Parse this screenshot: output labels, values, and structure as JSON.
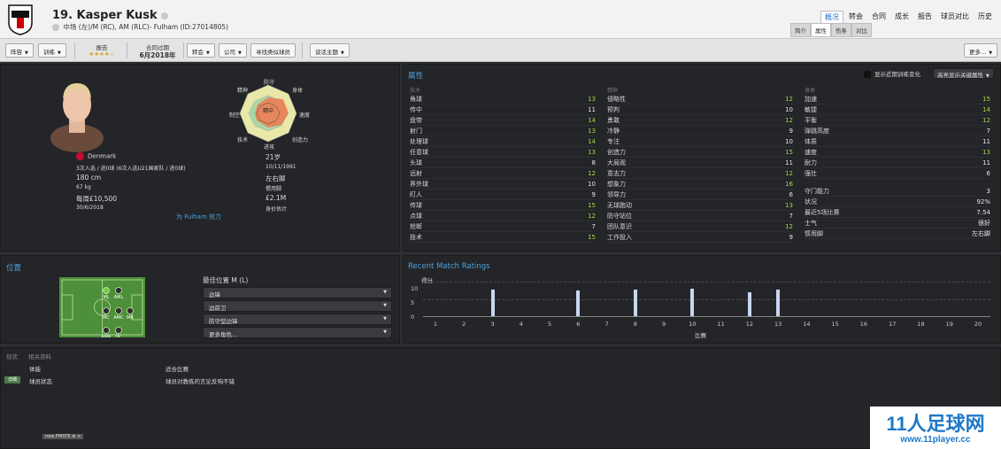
{
  "header": {
    "title": "19. Kasper Kusk",
    "subtitle": "中场 (左)/M (RC), AM (RLC)- Fulham (ID:27014805)",
    "nav": [
      "概况",
      "转会",
      "合同",
      "成长",
      "报告",
      "球员对比",
      "历史"
    ],
    "subnav": [
      "简介",
      "属性",
      "伤条",
      "对比"
    ]
  },
  "toolbar": {
    "lineup": "阵容",
    "training": "训练",
    "report_label": "报告",
    "report_stars": "★★★★☆",
    "contract_label": "合同过期",
    "contract_value": "6月2018年",
    "transfer": "转会",
    "club": "公司",
    "find_similar": "寻找类似球员",
    "talk": "谈话主题",
    "more": "更多..."
  },
  "profile": {
    "nation": "Denmark",
    "caps": "3次入选 / 进0球 (6次入选U21国家队 / 进0球)",
    "height": "180 cm",
    "weight": "67 kg",
    "wage": "每周£10,500",
    "contract_end": "30/6/2018",
    "age": "21岁",
    "dob": "10/11/1991",
    "foot": "左右脚",
    "foot_label": "惯用脚",
    "value": "£2.1M",
    "value_label": "身价估计",
    "club_link": "为 Fulham 效力"
  },
  "radar": {
    "labels": [
      "防守",
      "身体",
      "速度",
      "创造力",
      "进攻",
      "技术",
      "制空",
      "精神"
    ],
    "center": "精中"
  },
  "attributes": {
    "title": "属性",
    "toggle": "显示近期训练变化",
    "highlight": "高亮显示关键属性",
    "technical_header": "技术",
    "technical": [
      [
        "角球",
        "13"
      ],
      [
        "传中",
        "11"
      ],
      [
        "盘带",
        "14"
      ],
      [
        "射门",
        "13"
      ],
      [
        "处理球",
        "14"
      ],
      [
        "任意球",
        "13"
      ],
      [
        "头球",
        "8"
      ],
      [
        "远射",
        "12"
      ],
      [
        "界外球",
        "10"
      ],
      [
        "盯人",
        "9"
      ],
      [
        "传球",
        "15"
      ],
      [
        "点球",
        "12"
      ],
      [
        "抢断",
        "7"
      ],
      [
        "技术",
        "15"
      ]
    ],
    "mental_header": "精神",
    "mental": [
      [
        "侵略性",
        "12"
      ],
      [
        "预判",
        "10"
      ],
      [
        "勇敢",
        "12"
      ],
      [
        "冷静",
        "9"
      ],
      [
        "专注",
        "10"
      ],
      [
        "创造力",
        "15"
      ],
      [
        "大局观",
        "11"
      ],
      [
        "意志力",
        "12"
      ],
      [
        "想象力",
        "16"
      ],
      [
        "领导力",
        "6"
      ],
      [
        "无球跑动",
        "13"
      ],
      [
        "防守站位",
        "7"
      ],
      [
        "团队意识",
        "12"
      ],
      [
        "工作投入",
        "9"
      ]
    ],
    "physical_header": "身体",
    "physical": [
      [
        "加速",
        "15"
      ],
      [
        "敏捷",
        "14"
      ],
      [
        "平衡",
        "12"
      ],
      [
        "弹跳高度",
        "7"
      ],
      [
        "体质",
        "11"
      ],
      [
        "速度",
        "13"
      ],
      [
        "耐力",
        "11"
      ],
      [
        "强壮",
        "6"
      ]
    ],
    "gk": [
      [
        "守门能力",
        "3"
      ],
      [
        "状况",
        "92%"
      ],
      [
        "最近5场比赛",
        "7.54"
      ],
      [
        "士气",
        "很好"
      ],
      [
        "惯用脚",
        "左右脚"
      ]
    ]
  },
  "position": {
    "title": "位置",
    "best_label": "最佳位置 M (L)",
    "roles": [
      "边锋",
      "边前卫",
      "防守型边锋",
      "更多角色..."
    ],
    "pitch_labels": [
      "ML",
      "AML",
      "MC",
      "AMC",
      "MR",
      "AMR",
      "DC"
    ]
  },
  "ratings": {
    "title": "Recent Match Ratings",
    "ylabel": "得分",
    "xlabel": "比赛",
    "y_ticks": [
      "10",
      "5",
      "0"
    ]
  },
  "chart_data": {
    "type": "bar",
    "title": "Recent Match Ratings",
    "xlabel": "比赛",
    "ylabel": "得分",
    "categories": [
      "1",
      "2",
      "3",
      "4",
      "5",
      "6",
      "7",
      "8",
      "9",
      "10",
      "11",
      "12",
      "13",
      "14",
      "15",
      "16",
      "17",
      "18",
      "19",
      "20"
    ],
    "values": [
      null,
      null,
      7.5,
      null,
      null,
      7.2,
      null,
      7.5,
      null,
      7.8,
      null,
      6.8,
      7.5,
      null,
      null,
      null,
      null,
      null,
      null,
      null
    ],
    "ylim": [
      0,
      10
    ]
  },
  "status": {
    "tabs": [
      "现状",
      "相关资料"
    ],
    "rows": [
      [
        "体能",
        "适合比赛"
      ],
      [
        "球员状态",
        "球员对教练的言论反响不错"
      ]
    ],
    "badge": "详细",
    "footer_tag": "new FMSTE"
  },
  "watermark": {
    "line1": "11人足球网",
    "line2": "www.11player.cc"
  },
  "colors": {
    "accent": "#4aa3e0",
    "good": "#9ed84a",
    "panel": "#242528"
  }
}
